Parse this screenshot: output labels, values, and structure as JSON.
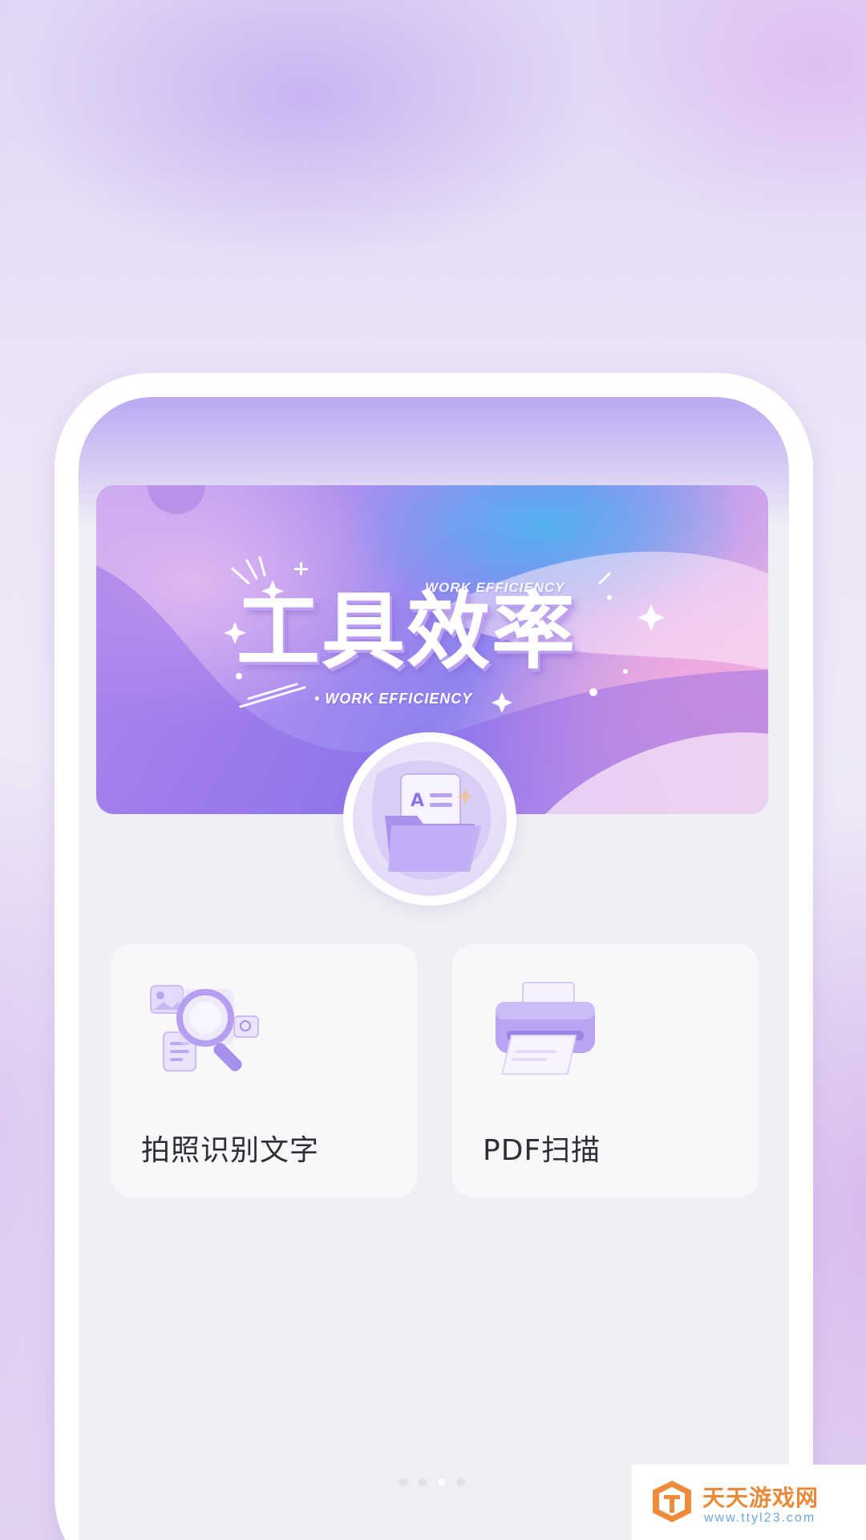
{
  "banner": {
    "title": "工具效率",
    "subtitle_top": "WORK EFFICIENCY",
    "subtitle_bottom": "• WORK EFFICIENCY"
  },
  "center_icon": "document-folder-icon",
  "cards": [
    {
      "label": "拍照识别文字",
      "icon": "magnifier-scan-icon"
    },
    {
      "label": "PDF扫描",
      "icon": "printer-icon"
    }
  ],
  "pager": {
    "count": 4,
    "active_index": 2
  },
  "watermark": {
    "name": "天天游戏网",
    "url": "www.ttyl23.com"
  },
  "colors": {
    "accent": "#a78bef",
    "card_bg": "#f8f8fa",
    "screen_bg": "#f0eff4",
    "label_text": "#2f2f33"
  }
}
